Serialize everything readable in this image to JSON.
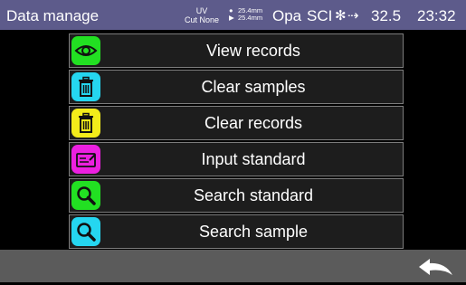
{
  "status_bar": {
    "title": "Data manage",
    "uv": "UV",
    "cut": "Cut None",
    "path_top": "25.4mm",
    "path_bottom": "25.4mm",
    "mode": "Opa",
    "scale": "SCI",
    "temperature": "32.5",
    "time": "23:32",
    "bluetooth_icon": "bluetooth-icon",
    "usb_icon": "usb-icon"
  },
  "menu": {
    "items": [
      {
        "label": "View records",
        "icon": "eye-icon",
        "icon_color": "#22e022"
      },
      {
        "label": "Clear samples",
        "icon": "trash-icon",
        "icon_color": "#25d6f0"
      },
      {
        "label": "Clear records",
        "icon": "trash-icon",
        "icon_color": "#f3ec1a"
      },
      {
        "label": "Input standard",
        "icon": "edit-card-icon",
        "icon_color": "#ec20e0"
      },
      {
        "label": "Search standard",
        "icon": "search-icon",
        "icon_color": "#22e022"
      },
      {
        "label": "Search sample",
        "icon": "search-icon",
        "icon_color": "#25d6f0"
      }
    ]
  },
  "bottom_bar": {
    "back_icon": "back-arrow-icon"
  }
}
